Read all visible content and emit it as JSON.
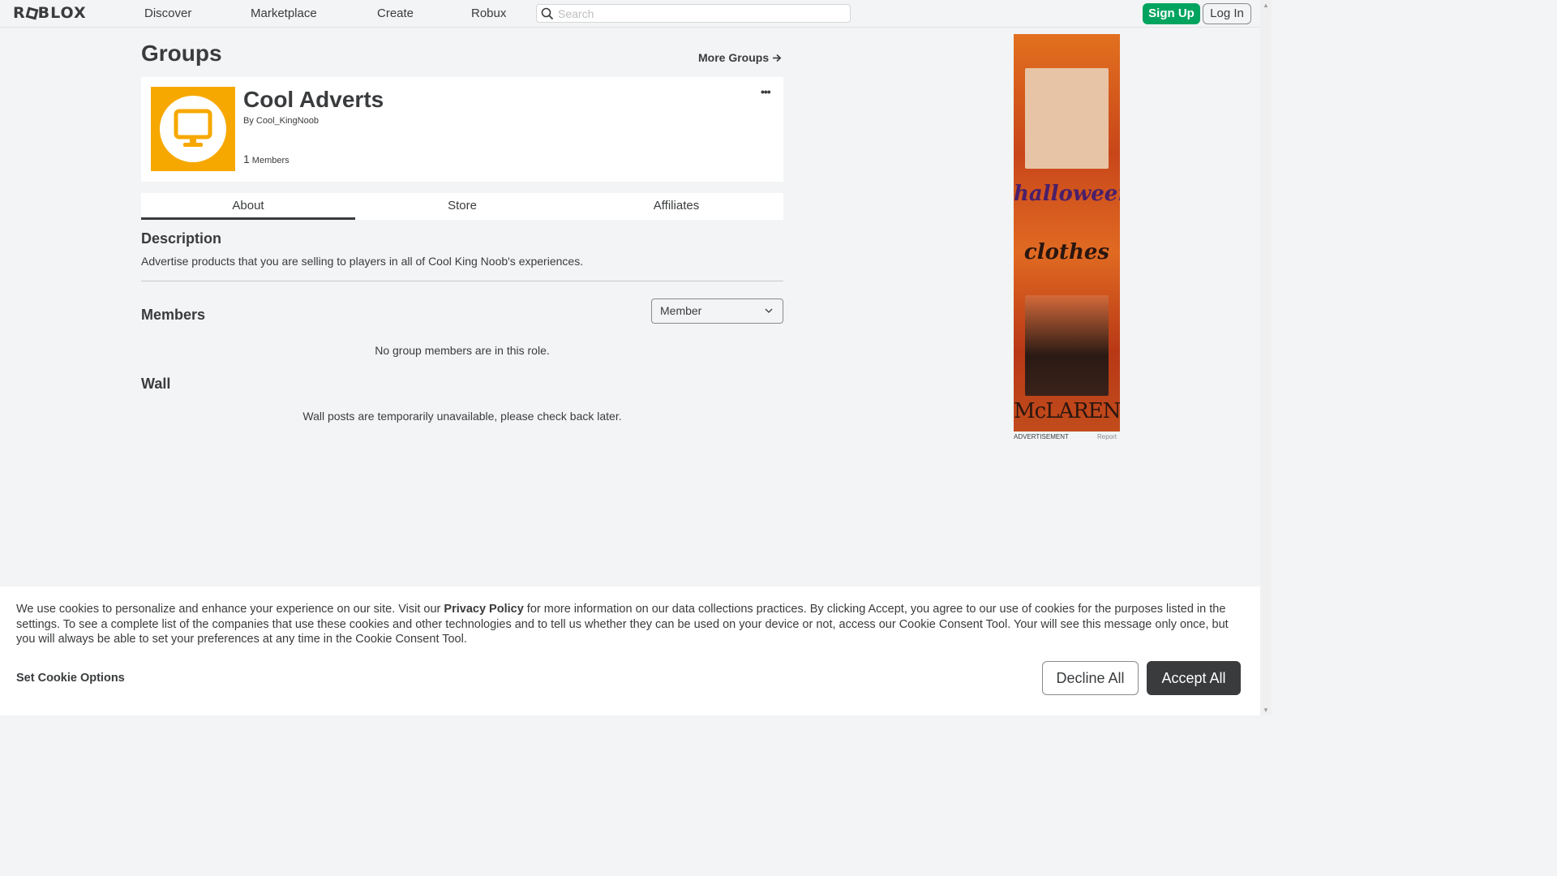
{
  "nav": {
    "logo": "ROBLOX",
    "links": [
      "Discover",
      "Marketplace",
      "Create",
      "Robux"
    ],
    "search_placeholder": "Search",
    "signup": "Sign Up",
    "login": "Log In"
  },
  "page": {
    "title": "Groups",
    "more_groups": "More Groups"
  },
  "group": {
    "name": "Cool Adverts",
    "by_label": "By",
    "owner": "Cool_KingNoob",
    "member_count": "1",
    "member_label": "Members",
    "more": "•••",
    "icon_color": "#f7a800"
  },
  "tabs": [
    "About",
    "Store",
    "Affiliates"
  ],
  "about": {
    "description_title": "Description",
    "description": "Advertise products that you are selling to players in all of Cool King Noob's experiences.",
    "members_title": "Members",
    "role_selected": "Member",
    "members_empty": "No group members are in this role.",
    "wall_title": "Wall",
    "wall_empty": "Wall posts are temporarily unavailable, please check back later."
  },
  "ad": {
    "text1": "halloween",
    "text2": "clothes",
    "text3": "McLAREN",
    "label": "ADVERTISEMENT",
    "report": "Report"
  },
  "cookie": {
    "text_before": "We use cookies to personalize and enhance your experience on our site. Visit our ",
    "policy_link": "Privacy Policy",
    "text_after": " for more information on our data collections practices. By clicking Accept, you agree to our use of cookies for the purposes listed in the settings. To see a complete list of the companies that use these cookies and other technologies and to tell us whether they can be used on your device or not, access our Cookie Consent Tool. Your will see this message only once, but you will always be able to set your preferences at any time in the Cookie Consent Tool.",
    "options": "Set Cookie Options",
    "decline": "Decline All",
    "accept": "Accept All"
  },
  "colors": {
    "accent_green": "#00a45f",
    "text": "#393b3d",
    "background": "#f2f4f5"
  }
}
